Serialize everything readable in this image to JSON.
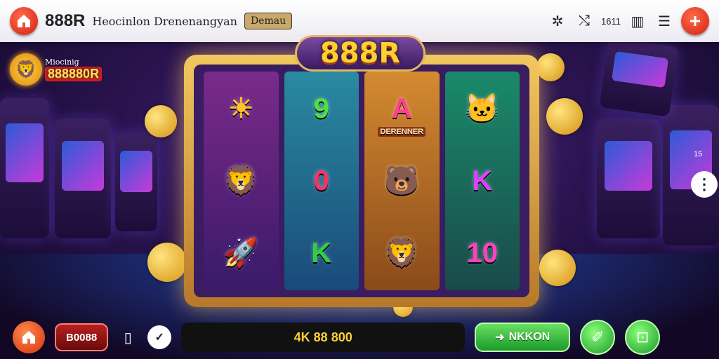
{
  "topbar": {
    "brand": "888R",
    "subtitle": "Heocinlon Drenenangyan",
    "pill_label": "Demau",
    "counter": "1611"
  },
  "badge": {
    "small_text": "Miocinig",
    "big_text": "888880R"
  },
  "machine": {
    "logo": "888R",
    "reels": [
      [
        {
          "glyph": "☀",
          "icon": "sun-symbol",
          "color": "#ffc030"
        },
        {
          "glyph": "🦁",
          "icon": "lion-symbol",
          "color": "#ffb020"
        },
        {
          "glyph": "🚀",
          "icon": "rocket-symbol",
          "color": "#60a0ff"
        }
      ],
      [
        {
          "glyph": "9",
          "icon": "nine-symbol",
          "color": "#50e040"
        },
        {
          "glyph": "0",
          "icon": "zero-symbol",
          "color": "#ff3060"
        },
        {
          "glyph": "K",
          "icon": "k-green-symbol",
          "color": "#30d040"
        }
      ],
      [
        {
          "glyph": "A",
          "icon": "a-symbol",
          "color": "#ff4090",
          "label": "DERENNER"
        },
        {
          "glyph": "🐻",
          "icon": "bear-symbol",
          "color": "#ff60a0"
        },
        {
          "glyph": "🦁",
          "icon": "lion-gold-symbol",
          "color": "#ffd040"
        }
      ],
      [
        {
          "glyph": "🐱",
          "icon": "panther-symbol",
          "color": "#40b0ff"
        },
        {
          "glyph": "K",
          "icon": "k-purple-symbol",
          "color": "#e040ff"
        },
        {
          "glyph": "10",
          "icon": "ten-symbol",
          "color": "#ff40c0"
        }
      ]
    ]
  },
  "side": {
    "note": "15",
    "dot": "⋮"
  },
  "bottombar": {
    "balance": "B0088",
    "bet": "4K 88 800",
    "spin_label": "NKKON"
  }
}
